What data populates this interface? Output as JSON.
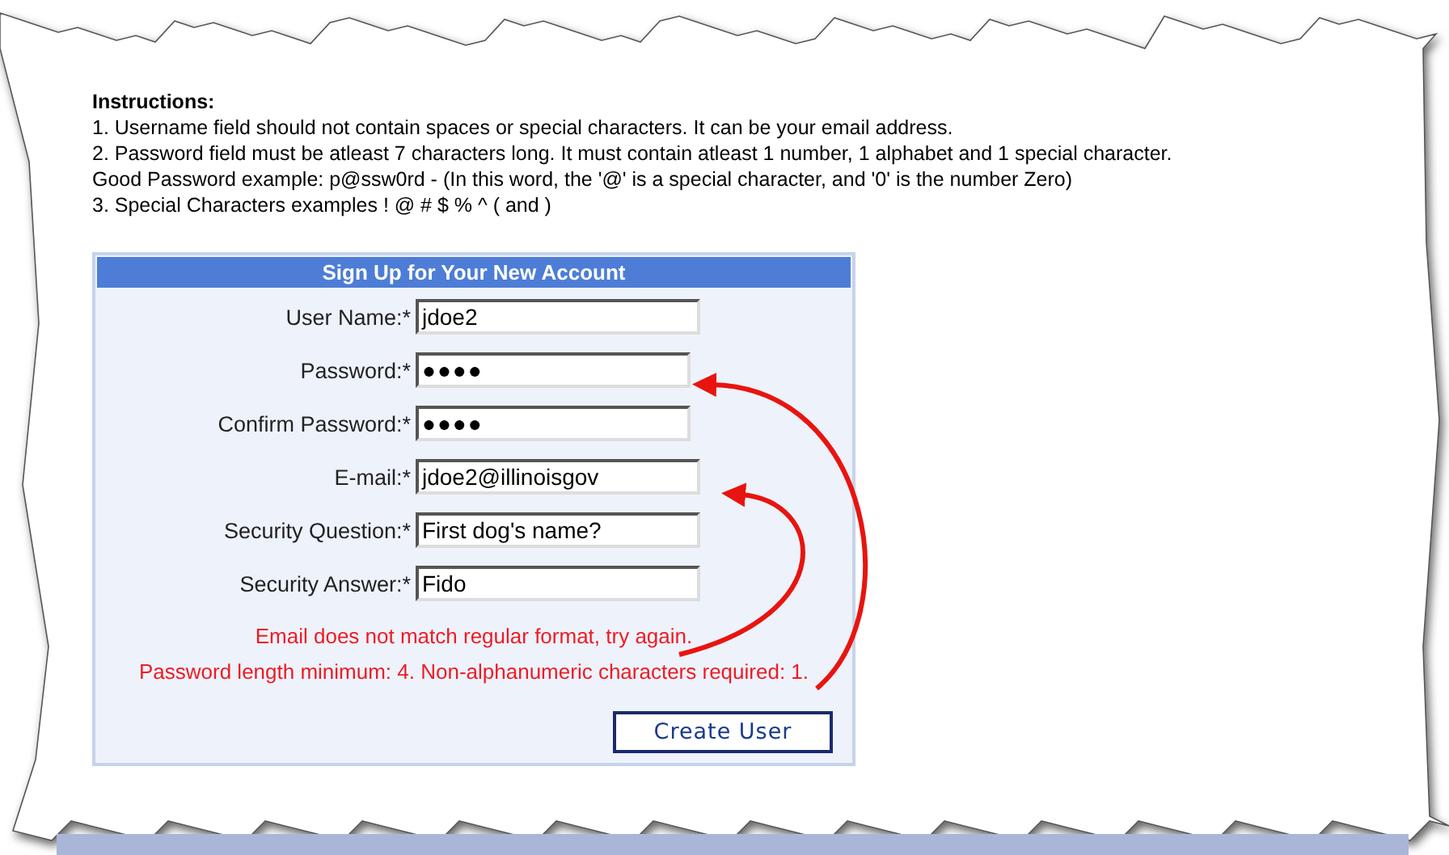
{
  "instructions": {
    "heading": "Instructions:",
    "lines": [
      "1. Username field should not contain spaces or special characters. It can be your email address.",
      "2. Password field must be atleast 7 characters long. It must contain atleast 1 number, 1 alphabet and 1 special character.",
      "Good Password example: p@ssw0rd - (In this word, the '@' is a special character, and '0' is the number Zero)",
      "3. Special Characters examples ! @ # $ % ^ ( and )"
    ]
  },
  "form": {
    "title": "Sign Up for Your New Account",
    "fields": [
      {
        "label": "User Name:*",
        "value": "jdoe2",
        "kind": "text"
      },
      {
        "label": "Password:*",
        "value": "●●●●",
        "kind": "password"
      },
      {
        "label": "Confirm Password:*",
        "value": "●●●●",
        "kind": "password"
      },
      {
        "label": "E-mail:*",
        "value": "jdoe2@illinoisgov",
        "kind": "text"
      },
      {
        "label": "Security Question:*",
        "value": "First dog's name?",
        "kind": "text"
      },
      {
        "label": "Security Answer:*",
        "value": "Fido",
        "kind": "text"
      }
    ],
    "errors": [
      "Email does not match regular format, try again.",
      "Password length minimum: 4. Non-alphanumeric characters required: 1."
    ],
    "submit": "Create User"
  }
}
